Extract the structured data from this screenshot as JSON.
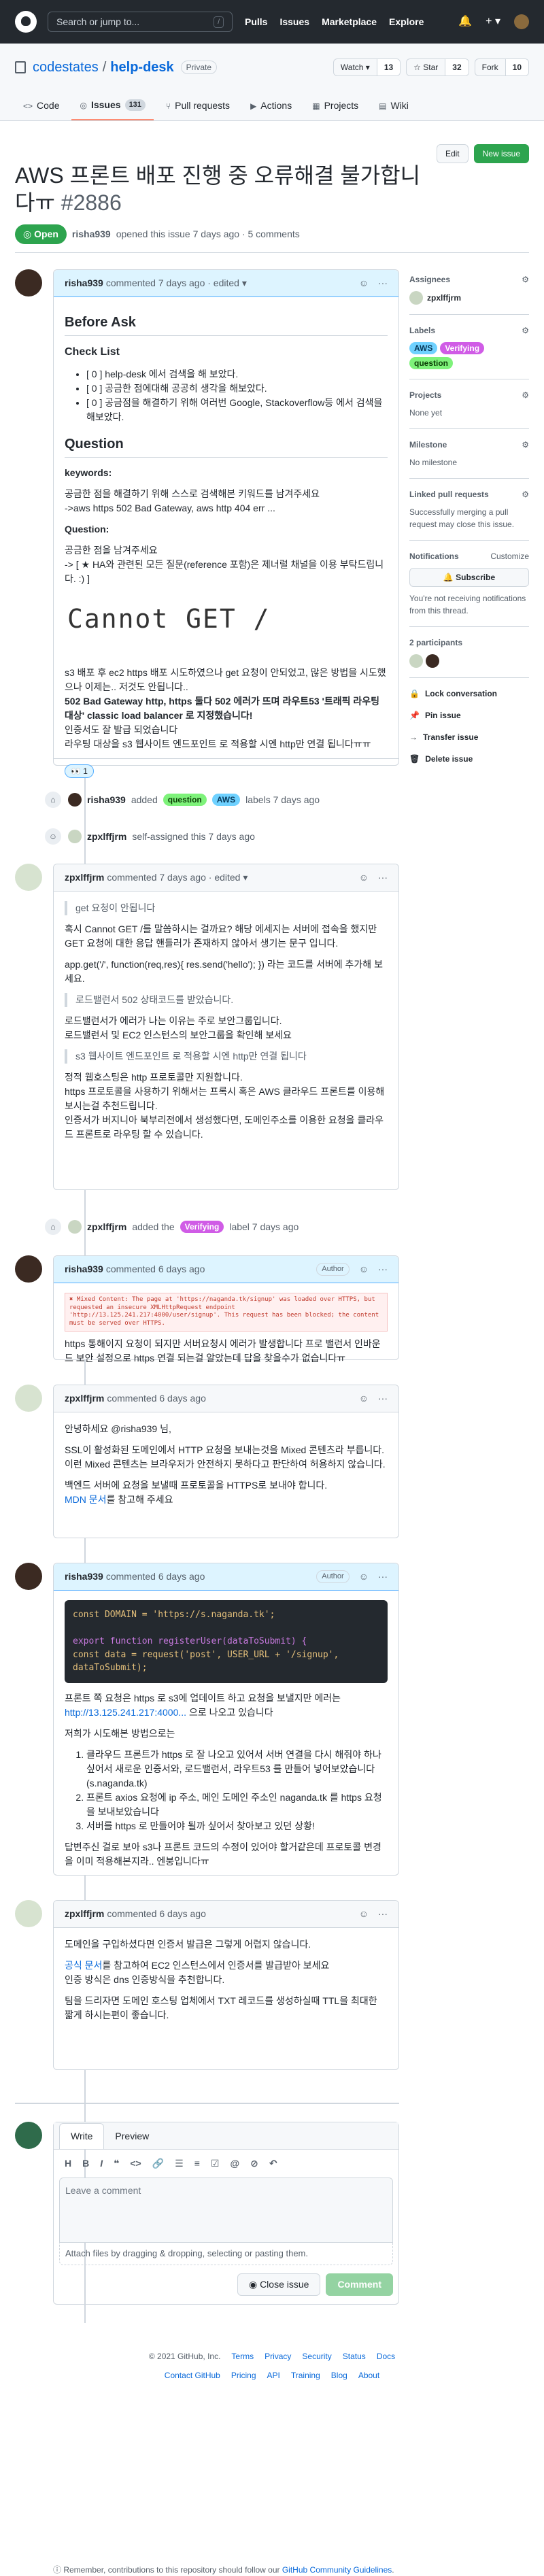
{
  "header": {
    "search_placeholder": "Search or jump to...",
    "slash": "/",
    "nav": [
      "Pulls",
      "Issues",
      "Marketplace",
      "Explore"
    ],
    "plus": "+ ▾"
  },
  "repo": {
    "owner": "codestates",
    "sep": "/",
    "name": "help-desk",
    "visibility": "Private",
    "watch": {
      "label": "Watch ▾",
      "count": "13"
    },
    "star": {
      "label": "☆ Star",
      "count": "32"
    },
    "fork": {
      "label": "Fork",
      "count": "10"
    },
    "tabs": [
      {
        "label": "Code"
      },
      {
        "label": "Issues",
        "count": "131"
      },
      {
        "label": "Pull requests"
      },
      {
        "label": "Actions"
      },
      {
        "label": "Projects"
      },
      {
        "label": "Wiki"
      }
    ]
  },
  "issue": {
    "title": "AWS 프론트 배포 진행 중 오류해결 불가합니다ㅠ",
    "number": "#2886",
    "state": "Open",
    "author": "risha939",
    "meta_text": "opened this issue 7 days ago · 5 comments",
    "edit": "Edit",
    "new_issue": "New issue"
  },
  "comments": [
    {
      "author": "risha939",
      "meta": "commented 7 days ago · edited ▾",
      "h_before": "Before Ask",
      "h_check": "Check List",
      "checks": [
        "[ 0 ] help-desk 에서 검색을 해 보았다.",
        "[ 0 ] 공금한 점에대해 공공히 생각을 해보았다.",
        "[ 0 ] 공금점을 해결하기 위해 여러번 Google, Stackoverflow등 에서 검색을 해보았다."
      ],
      "h_question": "Question",
      "keywords_label": "keywords:",
      "keywords_text": [
        "공금한 점을 해결하기 위해 스스로 검색해본 키워드를 남겨주세요",
        "->aws https 502 Bad Gateway, aws http 404 err ..."
      ],
      "question_label": "Question:",
      "question_text": [
        "공금한 점을 남겨주세요",
        "-> [ ★ HA와 관련된 모든 질문(reference 포함)은 제너럴 채널을 이용 부탁드립니다. :) ]"
      ],
      "image_text": "Cannot GET /",
      "body": [
        "s3 배포 후 ec2 https 배포 시도하였으나 get 요청이 안되었고, 많은 방법을 시도했으나 이제는.. 저것도 안됩니다..",
        "502 Bad Gateway http, https 둘다 502 에러가 뜨며 라우트53 '트래픽 라우팅 대상' classic load balancer 로 지정했습니다!",
        "인증서도 잘 발급 되었습니다",
        "라우팅 대상을 s3 웹사이트 엔드포인트 로 적용할 시엔 http만 연결 됩니다ㅠㅠ"
      ],
      "reaction": "1"
    },
    {
      "author": "zpxlffjrm",
      "meta": "commented 7 days ago · edited ▾",
      "q1": "get 요청이 안됩니다",
      "p1": "혹시 Cannot GET /를 말씀하시는 걸까요? 해당 에세지는 서버에 접속을 했지만 GET 요청에 대한 응답 핸들러가 존재하지 않아서 생기는 문구 입니다.",
      "p2": "app.get('/', function(req,res){ res.send('hello'); }) 라는 코드를 서버에 추가해 보세요.",
      "q2": "로드밸런서 502 상태코드를 받았습니다.",
      "p3": [
        "로드밸런서가 에러가 나는 이유는 주로 보안그룹입니다.",
        "로드밸런서 및 EC2 인스턴스의 보안그룹을 확인해 보세요"
      ],
      "q3": "s3 웹사이트 엔드포인트 로 적용할 시엔 http만 연결 됩니다",
      "p4": [
        "정적 웹호스팅은 http 프로토콜만 지원합니다.",
        "https 프로토콜을 사용하기 위해서는 프록시 혹은 AWS 클라우드 프론트를 이용해 보시는걸 추천드립니다.",
        "인증서가 버지니아 북부리전에서 생성했다면, 도메인주소를 이용한 요청을 클라우드 프론트로 라우팅 할 수 있습니다."
      ]
    },
    {
      "author": "risha939",
      "meta": "commented 6 days ago",
      "badge": "Author",
      "err1": "✖ Mixed Content: The page at 'https://naganda.tk/signup' was loaded over HTTPS, but requested an insecure XMLHttpRequest endpoint 'http://13.125.241.217:4000/user/signup'. This request has been blocked; the content must be served over HTTPS.",
      "p": "https 통해이지 요청이 되지만 서버요청시 에러가 발생합니다 프로 밸런서 인바운드 보안 설정으로 https 연결 되는걸 알았는데 답을 찾을수가 없습니다ㅠ"
    },
    {
      "author": "zpxlffjrm",
      "meta": "commented 6 days ago",
      "greet": "안녕하세요 @risha939 님,",
      "p1": [
        "SSL이 활성화된 도메인에서 HTTP 요청을 보내는것을 Mixed 콘텐츠라 부릅니다.",
        "이런 Mixed 콘텐츠는 브라우저가 안전하지 못하다고 판단하여 허용하지 않습니다."
      ],
      "p2": "백엔드 서버에 요청을 보낼때 프로토콜을 HTTPS로 보내야 합니다.",
      "link": "MDN 문서",
      "link_after": "를 참고해 주세요"
    },
    {
      "author": "risha939",
      "meta": "commented 6 days ago",
      "badge": "Author",
      "code": [
        "const DOMAIN = 'https://s.naganda.tk';",
        "export function registerUser(dataToSubmit) {",
        "  const data = request('post', USER_URL + '/signup', dataToSubmit);"
      ],
      "p1": "프론트 쪽 요청은 https 로 s3에 업데이트 하고 요청을 보낼지만 에러는",
      "link": "http://13.125.241.217:4000...",
      "link_after": "으로 나오고 있습니다",
      "p2": "저희가 시도해본 방법으로는",
      "items": [
        "클라우드 프론트가 https 로 잘 나오고 있어서 서버 연결을 다시 해줘야 하나 싶어서 새로운 인증서와, 로드밸런서, 라우트53 를 만들어 넣어보았습니다 (s.naganda.tk)",
        "프론트 axios 요청에 ip 주소, 메인 도메인 주소인 naganda.tk 를 https 요청을 보내보았습니다",
        "서버를 https 로 만들어야 될까 싶어서 찾아보고 있던 상황!"
      ],
      "p3": "답변주신 걸로 보아 s3나 프론트 코드의 수정이 있어야 할거같은데 프로토콜 변경을 이미 적용해본지라.. 엔붕입니다ㅠ"
    },
    {
      "author": "zpxlffjrm",
      "meta": "commented 6 days ago",
      "p1": "도메인을 구입하셨다면 인증서 발급은 그렇게 어렵지 않습니다.",
      "link": "공식 문서",
      "link_after": "를 참고하여 EC2 인스턴스에서 인증서를 발급받아 보세요",
      "p2": "인증 방식은 dns 인증방식을 추천합니다.",
      "p3": "팀을 드리자면 도메인 호스팅 업체에서 TXT 레코드를 생성하실때 TTL을 최대한 짧게 하시는편이 좋습니다."
    }
  ],
  "events": [
    {
      "actor": "risha939",
      "pre": "added",
      "labels": [
        "question",
        "AWS"
      ],
      "post": "labels 7 days ago"
    },
    {
      "actor": "zpxlffjrm",
      "text": "self-assigned this 7 days ago"
    },
    {
      "actor": "zpxlffjrm",
      "pre": "added the",
      "labels": [
        "Verifying"
      ],
      "post": "label 7 days ago"
    }
  ],
  "sidebar": {
    "assignees": {
      "title": "Assignees",
      "value": "zpxlffjrm"
    },
    "labels": {
      "title": "Labels",
      "items": [
        "AWS",
        "Verifying",
        "question"
      ]
    },
    "projects": {
      "title": "Projects",
      "value": "None yet"
    },
    "milestone": {
      "title": "Milestone",
      "value": "No milestone"
    },
    "linked": {
      "title": "Linked pull requests",
      "value": "Successfully merging a pull request may close this issue."
    },
    "notifications": {
      "title": "Notifications",
      "customize": "Customize",
      "subscribe": "Subscribe",
      "note": "You're not receiving notifications from this thread."
    },
    "participants": {
      "title": "2 participants"
    },
    "actions": [
      "Lock conversation",
      "Pin issue",
      "Transfer issue",
      "Delete issue"
    ]
  },
  "form": {
    "write": "Write",
    "preview": "Preview",
    "placeholder": "Leave a comment",
    "attach": "Attach files by dragging & dropping, selecting or pasting them.",
    "close": "Close issue",
    "comment": "Comment",
    "contrib": "Remember, contributions to this repository should follow our",
    "contrib_link": "GitHub Community Guidelines",
    "contrib_end": "."
  },
  "footer": {
    "copy": "© 2021 GitHub, Inc.",
    "row1": [
      "Terms",
      "Privacy",
      "Security",
      "Status",
      "Docs"
    ],
    "row2": [
      "Contact GitHub",
      "Pricing",
      "API",
      "Training",
      "Blog",
      "About"
    ]
  },
  "colors": {
    "open": "#2da44e",
    "label_question": "#7ef27a",
    "label_aws": "#6fd1ff",
    "label_verifying": "#d05ce6"
  }
}
